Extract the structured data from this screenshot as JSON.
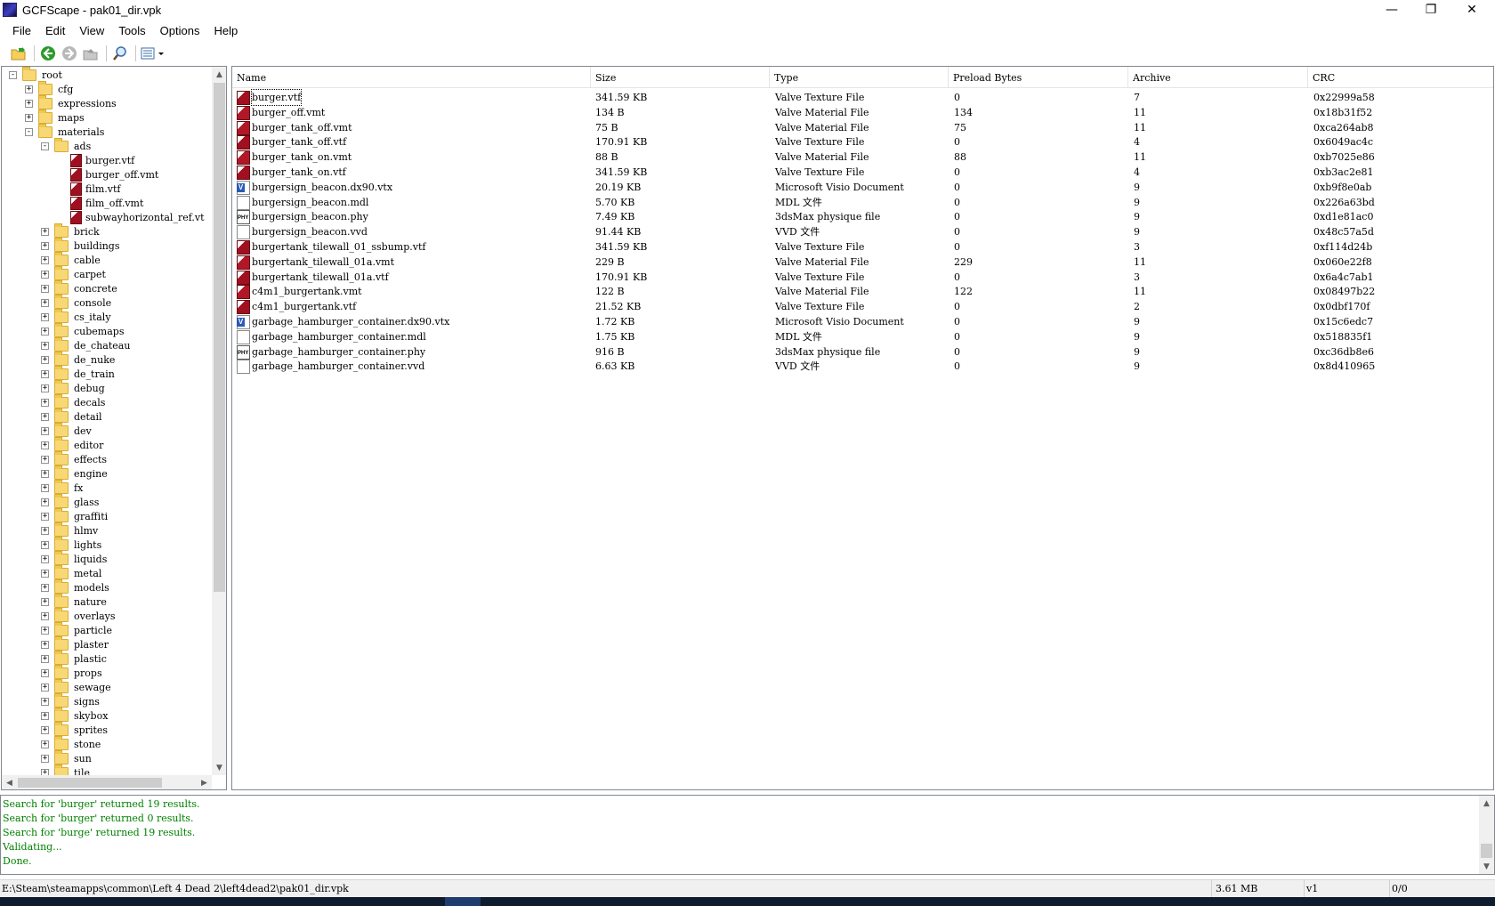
{
  "window": {
    "title": "GCFScape - pak01_dir.vpk",
    "minimize": "—",
    "maximize": "❐",
    "close": "✕"
  },
  "menu": [
    "File",
    "Edit",
    "View",
    "Tools",
    "Options",
    "Help"
  ],
  "toolbar": {
    "icons": [
      "open-folder-icon",
      "back-icon",
      "forward-icon",
      "up-icon",
      "search-icon",
      "view-mode-icon"
    ]
  },
  "tree": {
    "root": "root",
    "top_children": [
      "cfg",
      "expressions",
      "maps",
      "materials"
    ],
    "ads_folder": "ads",
    "ads_files": [
      "burger.vtf",
      "burger_off.vmt",
      "film.vtf",
      "film_off.vmt",
      "subwayhorizontal_ref.vt"
    ],
    "material_folders": [
      "brick",
      "buildings",
      "cable",
      "carpet",
      "concrete",
      "console",
      "cs_italy",
      "cubemaps",
      "de_chateau",
      "de_nuke",
      "de_train",
      "debug",
      "decals",
      "detail",
      "dev",
      "editor",
      "effects",
      "engine",
      "fx",
      "glass",
      "graffiti",
      "hlmv",
      "lights",
      "liquids",
      "metal",
      "models",
      "nature",
      "overlays",
      "particle",
      "plaster",
      "plastic",
      "props",
      "sewage",
      "signs",
      "skybox",
      "sprites",
      "stone",
      "sun",
      "tile"
    ]
  },
  "list": {
    "columns": [
      "Name",
      "Size",
      "Type",
      "Preload Bytes",
      "Archive",
      "CRC"
    ],
    "rows": [
      {
        "icon": "vtf",
        "name": "burger.vtf",
        "size": "341.59 KB",
        "type": "Valve Texture File",
        "preload": "0",
        "archive": "7",
        "crc": "0x22999a58"
      },
      {
        "icon": "vmt",
        "name": "burger_off.vmt",
        "size": "134 B",
        "type": "Valve Material File",
        "preload": "134",
        "archive": "11",
        "crc": "0x18b31f52"
      },
      {
        "icon": "vmt",
        "name": "burger_tank_off.vmt",
        "size": "75 B",
        "type": "Valve Material File",
        "preload": "75",
        "archive": "11",
        "crc": "0xca264ab8"
      },
      {
        "icon": "vtf",
        "name": "burger_tank_off.vtf",
        "size": "170.91 KB",
        "type": "Valve Texture File",
        "preload": "0",
        "archive": "4",
        "crc": "0x6049ac4c"
      },
      {
        "icon": "vmt",
        "name": "burger_tank_on.vmt",
        "size": "88 B",
        "type": "Valve Material File",
        "preload": "88",
        "archive": "11",
        "crc": "0xb7025e86"
      },
      {
        "icon": "vtf",
        "name": "burger_tank_on.vtf",
        "size": "341.59 KB",
        "type": "Valve Texture File",
        "preload": "0",
        "archive": "4",
        "crc": "0xb3ac2e81"
      },
      {
        "icon": "vtx",
        "name": "burgersign_beacon.dx90.vtx",
        "size": "20.19 KB",
        "type": "Microsoft Visio Document",
        "preload": "0",
        "archive": "9",
        "crc": "0xb9f8e0ab"
      },
      {
        "icon": "blank",
        "name": "burgersign_beacon.mdl",
        "size": "5.70 KB",
        "type": "MDL 文件",
        "preload": "0",
        "archive": "9",
        "crc": "0x226a63bd"
      },
      {
        "icon": "phy",
        "name": "burgersign_beacon.phy",
        "size": "7.49 KB",
        "type": "3dsMax physique file",
        "preload": "0",
        "archive": "9",
        "crc": "0xd1e81ac0"
      },
      {
        "icon": "blank",
        "name": "burgersign_beacon.vvd",
        "size": "91.44 KB",
        "type": "VVD 文件",
        "preload": "0",
        "archive": "9",
        "crc": "0x48c57a5d"
      },
      {
        "icon": "vtf",
        "name": "burgertank_tilewall_01_ssbump.vtf",
        "size": "341.59 KB",
        "type": "Valve Texture File",
        "preload": "0",
        "archive": "3",
        "crc": "0xf114d24b"
      },
      {
        "icon": "vmt",
        "name": "burgertank_tilewall_01a.vmt",
        "size": "229 B",
        "type": "Valve Material File",
        "preload": "229",
        "archive": "11",
        "crc": "0x060e22f8"
      },
      {
        "icon": "vtf",
        "name": "burgertank_tilewall_01a.vtf",
        "size": "170.91 KB",
        "type": "Valve Texture File",
        "preload": "0",
        "archive": "3",
        "crc": "0x6a4c7ab1"
      },
      {
        "icon": "vmt",
        "name": "c4m1_burgertank.vmt",
        "size": "122 B",
        "type": "Valve Material File",
        "preload": "122",
        "archive": "11",
        "crc": "0x08497b22"
      },
      {
        "icon": "vtf",
        "name": "c4m1_burgertank.vtf",
        "size": "21.52 KB",
        "type": "Valve Texture File",
        "preload": "0",
        "archive": "2",
        "crc": "0x0dbf170f"
      },
      {
        "icon": "vtx",
        "name": "garbage_hamburger_container.dx90.vtx",
        "size": "1.72 KB",
        "type": "Microsoft Visio Document",
        "preload": "0",
        "archive": "9",
        "crc": "0x15c6edc7"
      },
      {
        "icon": "blank",
        "name": "garbage_hamburger_container.mdl",
        "size": "1.75 KB",
        "type": "MDL 文件",
        "preload": "0",
        "archive": "9",
        "crc": "0x518835f1"
      },
      {
        "icon": "phy",
        "name": "garbage_hamburger_container.phy",
        "size": "916 B",
        "type": "3dsMax physique file",
        "preload": "0",
        "archive": "9",
        "crc": "0xc36db8e6"
      },
      {
        "icon": "blank",
        "name": "garbage_hamburger_container.vvd",
        "size": "6.63 KB",
        "type": "VVD 文件",
        "preload": "0",
        "archive": "9",
        "crc": "0x8d410965"
      }
    ]
  },
  "log": [
    "Search for 'burger' returned 19 results.",
    "Search for 'burger' returned 0 results.",
    "Search for 'burge' returned 19 results.",
    "Validating...",
    "Done."
  ],
  "status": {
    "path": "E:\\Steam\\steamapps\\common\\Left 4 Dead 2\\left4dead2\\pak01_dir.vpk",
    "size": "3.61 MB",
    "version": "v1",
    "count": "0/0"
  },
  "colors": {
    "log_text": "#008000",
    "folder": "#f8d775",
    "texture_icon": "#a01020"
  }
}
